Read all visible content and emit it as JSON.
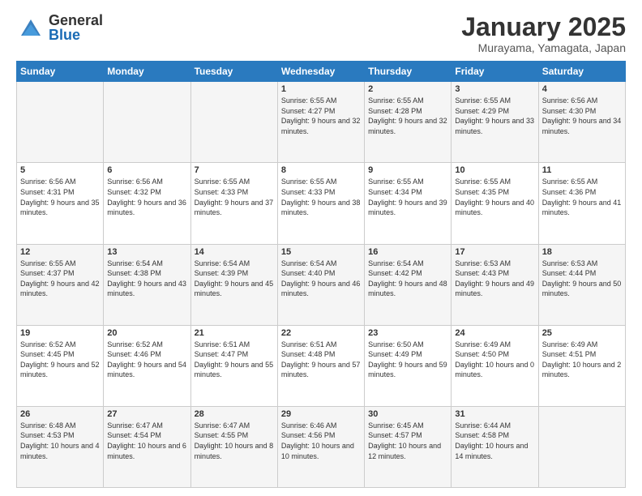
{
  "header": {
    "logo_general": "General",
    "logo_blue": "Blue",
    "month_title": "January 2025",
    "subtitle": "Murayama, Yamagata, Japan"
  },
  "days_of_week": [
    "Sunday",
    "Monday",
    "Tuesday",
    "Wednesday",
    "Thursday",
    "Friday",
    "Saturday"
  ],
  "weeks": [
    [
      {
        "day": "",
        "info": ""
      },
      {
        "day": "",
        "info": ""
      },
      {
        "day": "",
        "info": ""
      },
      {
        "day": "1",
        "info": "Sunrise: 6:55 AM\nSunset: 4:27 PM\nDaylight: 9 hours and 32 minutes."
      },
      {
        "day": "2",
        "info": "Sunrise: 6:55 AM\nSunset: 4:28 PM\nDaylight: 9 hours and 32 minutes."
      },
      {
        "day": "3",
        "info": "Sunrise: 6:55 AM\nSunset: 4:29 PM\nDaylight: 9 hours and 33 minutes."
      },
      {
        "day": "4",
        "info": "Sunrise: 6:56 AM\nSunset: 4:30 PM\nDaylight: 9 hours and 34 minutes."
      }
    ],
    [
      {
        "day": "5",
        "info": "Sunrise: 6:56 AM\nSunset: 4:31 PM\nDaylight: 9 hours and 35 minutes."
      },
      {
        "day": "6",
        "info": "Sunrise: 6:56 AM\nSunset: 4:32 PM\nDaylight: 9 hours and 36 minutes."
      },
      {
        "day": "7",
        "info": "Sunrise: 6:55 AM\nSunset: 4:33 PM\nDaylight: 9 hours and 37 minutes."
      },
      {
        "day": "8",
        "info": "Sunrise: 6:55 AM\nSunset: 4:33 PM\nDaylight: 9 hours and 38 minutes."
      },
      {
        "day": "9",
        "info": "Sunrise: 6:55 AM\nSunset: 4:34 PM\nDaylight: 9 hours and 39 minutes."
      },
      {
        "day": "10",
        "info": "Sunrise: 6:55 AM\nSunset: 4:35 PM\nDaylight: 9 hours and 40 minutes."
      },
      {
        "day": "11",
        "info": "Sunrise: 6:55 AM\nSunset: 4:36 PM\nDaylight: 9 hours and 41 minutes."
      }
    ],
    [
      {
        "day": "12",
        "info": "Sunrise: 6:55 AM\nSunset: 4:37 PM\nDaylight: 9 hours and 42 minutes."
      },
      {
        "day": "13",
        "info": "Sunrise: 6:54 AM\nSunset: 4:38 PM\nDaylight: 9 hours and 43 minutes."
      },
      {
        "day": "14",
        "info": "Sunrise: 6:54 AM\nSunset: 4:39 PM\nDaylight: 9 hours and 45 minutes."
      },
      {
        "day": "15",
        "info": "Sunrise: 6:54 AM\nSunset: 4:40 PM\nDaylight: 9 hours and 46 minutes."
      },
      {
        "day": "16",
        "info": "Sunrise: 6:54 AM\nSunset: 4:42 PM\nDaylight: 9 hours and 48 minutes."
      },
      {
        "day": "17",
        "info": "Sunrise: 6:53 AM\nSunset: 4:43 PM\nDaylight: 9 hours and 49 minutes."
      },
      {
        "day": "18",
        "info": "Sunrise: 6:53 AM\nSunset: 4:44 PM\nDaylight: 9 hours and 50 minutes."
      }
    ],
    [
      {
        "day": "19",
        "info": "Sunrise: 6:52 AM\nSunset: 4:45 PM\nDaylight: 9 hours and 52 minutes."
      },
      {
        "day": "20",
        "info": "Sunrise: 6:52 AM\nSunset: 4:46 PM\nDaylight: 9 hours and 54 minutes."
      },
      {
        "day": "21",
        "info": "Sunrise: 6:51 AM\nSunset: 4:47 PM\nDaylight: 9 hours and 55 minutes."
      },
      {
        "day": "22",
        "info": "Sunrise: 6:51 AM\nSunset: 4:48 PM\nDaylight: 9 hours and 57 minutes."
      },
      {
        "day": "23",
        "info": "Sunrise: 6:50 AM\nSunset: 4:49 PM\nDaylight: 9 hours and 59 minutes."
      },
      {
        "day": "24",
        "info": "Sunrise: 6:49 AM\nSunset: 4:50 PM\nDaylight: 10 hours and 0 minutes."
      },
      {
        "day": "25",
        "info": "Sunrise: 6:49 AM\nSunset: 4:51 PM\nDaylight: 10 hours and 2 minutes."
      }
    ],
    [
      {
        "day": "26",
        "info": "Sunrise: 6:48 AM\nSunset: 4:53 PM\nDaylight: 10 hours and 4 minutes."
      },
      {
        "day": "27",
        "info": "Sunrise: 6:47 AM\nSunset: 4:54 PM\nDaylight: 10 hours and 6 minutes."
      },
      {
        "day": "28",
        "info": "Sunrise: 6:47 AM\nSunset: 4:55 PM\nDaylight: 10 hours and 8 minutes."
      },
      {
        "day": "29",
        "info": "Sunrise: 6:46 AM\nSunset: 4:56 PM\nDaylight: 10 hours and 10 minutes."
      },
      {
        "day": "30",
        "info": "Sunrise: 6:45 AM\nSunset: 4:57 PM\nDaylight: 10 hours and 12 minutes."
      },
      {
        "day": "31",
        "info": "Sunrise: 6:44 AM\nSunset: 4:58 PM\nDaylight: 10 hours and 14 minutes."
      },
      {
        "day": "",
        "info": ""
      }
    ]
  ]
}
